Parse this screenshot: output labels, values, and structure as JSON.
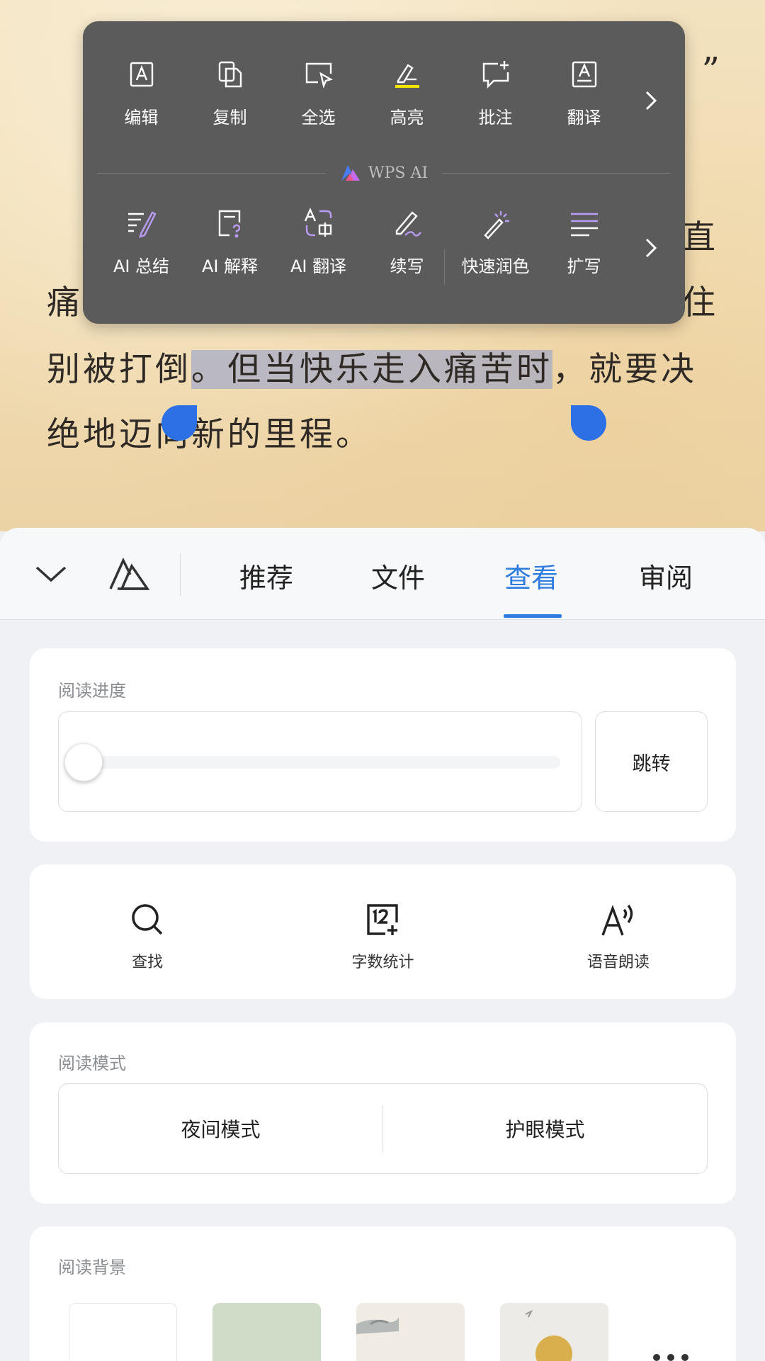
{
  "document": {
    "quote_mark": "”",
    "line_a_first": "",
    "line_a_last": "直",
    "line_b_first": "痛",
    "line_b_last": "住",
    "line_c_before": "别被打倒",
    "line_c_selected": "。但当快乐走入痛苦时",
    "line_c_after": "，就要决",
    "line_d": "绝地迈向新的里程。"
  },
  "popup": {
    "row1": [
      {
        "label": "编辑",
        "icon": "edit-icon"
      },
      {
        "label": "复制",
        "icon": "copy-icon"
      },
      {
        "label": "全选",
        "icon": "select-all-icon"
      },
      {
        "label": "高亮",
        "icon": "highlight-icon"
      },
      {
        "label": "批注",
        "icon": "comment-icon"
      },
      {
        "label": "翻译",
        "icon": "translate-icon"
      }
    ],
    "ai_badge": "WPS AI",
    "row2": [
      {
        "label": "AI 总结",
        "icon": "ai-summary-icon"
      },
      {
        "label": "AI 解释",
        "icon": "ai-explain-icon"
      },
      {
        "label": "AI 翻译",
        "icon": "ai-translate-icon"
      },
      {
        "label": "续写",
        "icon": "continue-writing-icon"
      },
      {
        "label": "快速润色",
        "icon": "magic-wand-icon"
      },
      {
        "label": "扩写",
        "icon": "expand-icon"
      }
    ],
    "highlight_color": "#f5e400",
    "ai_accent": "#b99cf5"
  },
  "tabs": {
    "items": [
      "推荐",
      "文件",
      "查看",
      "审阅"
    ],
    "active": "查看",
    "accent": "#2f7ce0"
  },
  "reading_progress": {
    "title": "阅读进度",
    "value": 0,
    "jump_label": "跳转"
  },
  "tools": [
    {
      "label": "查找",
      "icon": "search-icon"
    },
    {
      "label": "字数统计",
      "icon": "word-count-icon"
    },
    {
      "label": "语音朗读",
      "icon": "read-aloud-icon"
    }
  ],
  "reading_mode": {
    "title": "阅读模式",
    "night": "夜间模式",
    "eye_care": "护眼模式"
  },
  "reading_background": {
    "title": "阅读背景",
    "swatches": [
      "#ffffff",
      "#cfdcc8",
      "#f1ece3",
      "#ecebe7"
    ]
  }
}
